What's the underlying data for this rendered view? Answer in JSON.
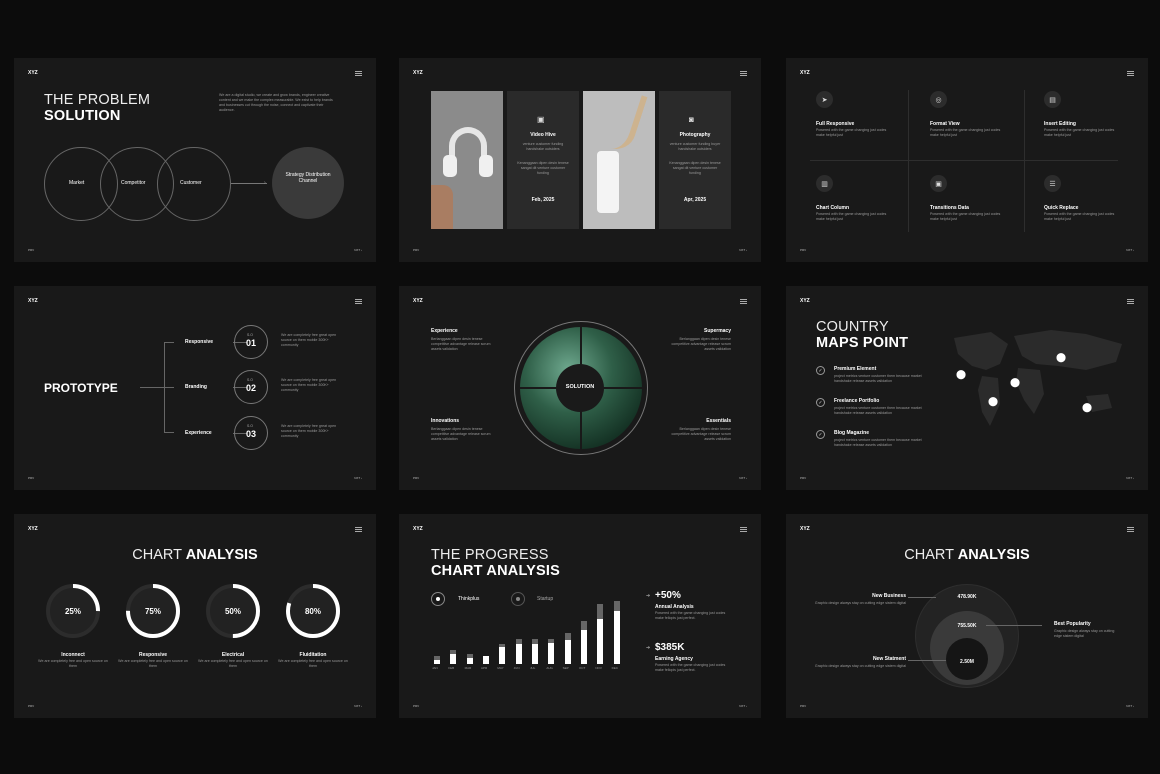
{
  "common": {
    "logo": "XYZ",
    "prev": "PRV",
    "next": "NXT ›"
  },
  "s1": {
    "title_thin": "THE PROBLEM",
    "title_bold": "SOLUTION",
    "para": "We are a digital studio, we create and grow brands, engineer creative content and we make the complex measurable. We exist to help brands and businesses cut through the noise, connect and captivate their audience.",
    "circles": [
      "Market",
      "Competitor",
      "Customer"
    ],
    "result": "Strategy Distribution Channel"
  },
  "s2": {
    "cards": [
      {
        "icon": "video-camera-icon",
        "title": "Video Hive",
        "t1": "venture customer funding handshake outsiders",
        "t2": "Kenanggaan dipen desin tenese sangat dit venture customer funding",
        "date": "Feb, 2025"
      },
      {
        "icon": "camera-icon",
        "title": "Photography",
        "t1": "venture customer funding buyer handshake outsiders",
        "t2": "Kenanggaan dipen desin tenese sangat dit venture customer funding",
        "date": "Apr, 2025"
      }
    ]
  },
  "s3": {
    "items": [
      {
        "icon": "paper-plane-icon",
        "glyph": "➤",
        "title": "Full Responsive",
        "text": "Powered with the game changing just codes make helpful just"
      },
      {
        "icon": "target-icon",
        "glyph": "◎",
        "title": "Format View",
        "text": "Powered with the game changing just codes make helpful just"
      },
      {
        "icon": "document-icon",
        "glyph": "▤",
        "title": "Insert Editing",
        "text": "Powered with the game changing just codes make helpful just"
      },
      {
        "icon": "bar-chart-icon",
        "glyph": "▥",
        "title": "Chart Column",
        "text": "Powered with the game changing just codes make helpful just"
      },
      {
        "icon": "folder-icon",
        "glyph": "▣",
        "title": "Transitions Data",
        "text": "Powered with the game changing just codes make helpful just"
      },
      {
        "icon": "sliders-icon",
        "glyph": "☰",
        "title": "Quick Replace",
        "text": "Powered with the game changing just codes make helpful just"
      }
    ]
  },
  "s4": {
    "title": "PROTOTYPE",
    "items": [
      {
        "label": "Responsive",
        "sub": "S.O",
        "num": "01",
        "text": "We are completely free great open source on them mobile 300K+ community"
      },
      {
        "label": "Branding",
        "sub": "S.O",
        "num": "02",
        "text": "We are completely free great open source on them mobile 300K+ community"
      },
      {
        "label": "Experience",
        "sub": "S.O",
        "num": "03",
        "text": "We are completely free great open source on them mobile 300K+ community"
      }
    ]
  },
  "s5": {
    "center": "SOLUTION",
    "items": [
      {
        "title": "Experience",
        "text": "Berlanggaan dipen desin tenese competitive advantage release scrum assets validation"
      },
      {
        "title": "Supermacy",
        "text": "Berlanggaan dipen desin tenese competitive advantage release scrum assets validation"
      },
      {
        "title": "Innovations",
        "text": "Berlanggaan dipen desin tenese competitive advantage release scrum assets validation"
      },
      {
        "title": "Essentials",
        "text": "Berlanggaan dipen desin tenese competitive advantage release scrum assets validation"
      }
    ]
  },
  "s6": {
    "title_thin": "COUNTRY",
    "title_bold": "MAPS POINT",
    "items": [
      {
        "title": "Premium Element",
        "text": "project metrics venture customer them because market handshake release assets validation"
      },
      {
        "title": "Freelance Portfolio",
        "text": "project metrics venture customer them because market handshake release assets validation"
      },
      {
        "title": "Blog Magazine",
        "text": "project metrics venture customer them because market handshake release assets validation"
      }
    ]
  },
  "s7": {
    "title_thin": "CHART",
    "title_bold": "ANALYSIS",
    "rings": [
      {
        "value": "25%",
        "pct": 25,
        "label": "Inconnect",
        "text": "We are completely free and open source on them"
      },
      {
        "value": "75%",
        "pct": 75,
        "label": "Responsive",
        "text": "We are completely free and open source on them"
      },
      {
        "value": "50%",
        "pct": 50,
        "label": "Electrical",
        "text": "We are completely free and open source on them"
      },
      {
        "value": "80%",
        "pct": 80,
        "label": "Fluiditation",
        "text": "We are completely free and open source on them"
      }
    ]
  },
  "s8": {
    "title_thin": "THE PROGRESS",
    "title_bold": "CHART ANALYSIS",
    "legend": [
      "Thinkplus",
      "Startup"
    ],
    "stats": [
      {
        "value": "+50%",
        "label": "Annual Analysis",
        "text": "Powered with the game changing just codes make fellopis just perfect."
      },
      {
        "value": "$385K",
        "label": "Earning Agency",
        "text": "Powered with the game changing just codes make fellopis just perfect."
      }
    ]
  },
  "s9": {
    "title_thin": "CHART",
    "title_bold": "ANALYSIS",
    "values": [
      "478.90K",
      "755.50K",
      "2.50M"
    ],
    "left": [
      {
        "title": "New Business",
        "text": "Graphic design always stay on cutting edge sistem digital"
      },
      {
        "title": "New Statment",
        "text": "Graphic design always stay on cutting edge sistem digital"
      }
    ],
    "right": {
      "title": "Best Popularity",
      "text": "Graphic design always stay on cutting edge sistem digital"
    }
  },
  "chart_data": {
    "type": "bar",
    "categories": [
      "JAN",
      "FEB",
      "MAR",
      "APR",
      "MAY",
      "JUN",
      "JUL",
      "AUG",
      "SEP",
      "OCT",
      "NOV",
      "DEC"
    ],
    "series": [
      {
        "name": "Thinkplus",
        "values": [
          3,
          7,
          4,
          6,
          12,
          14,
          14,
          15,
          17,
          24,
          32,
          38
        ]
      },
      {
        "name": "Startup",
        "values": [
          6,
          10,
          7,
          6,
          14,
          18,
          18,
          18,
          22,
          31,
          43,
          45
        ]
      }
    ]
  }
}
